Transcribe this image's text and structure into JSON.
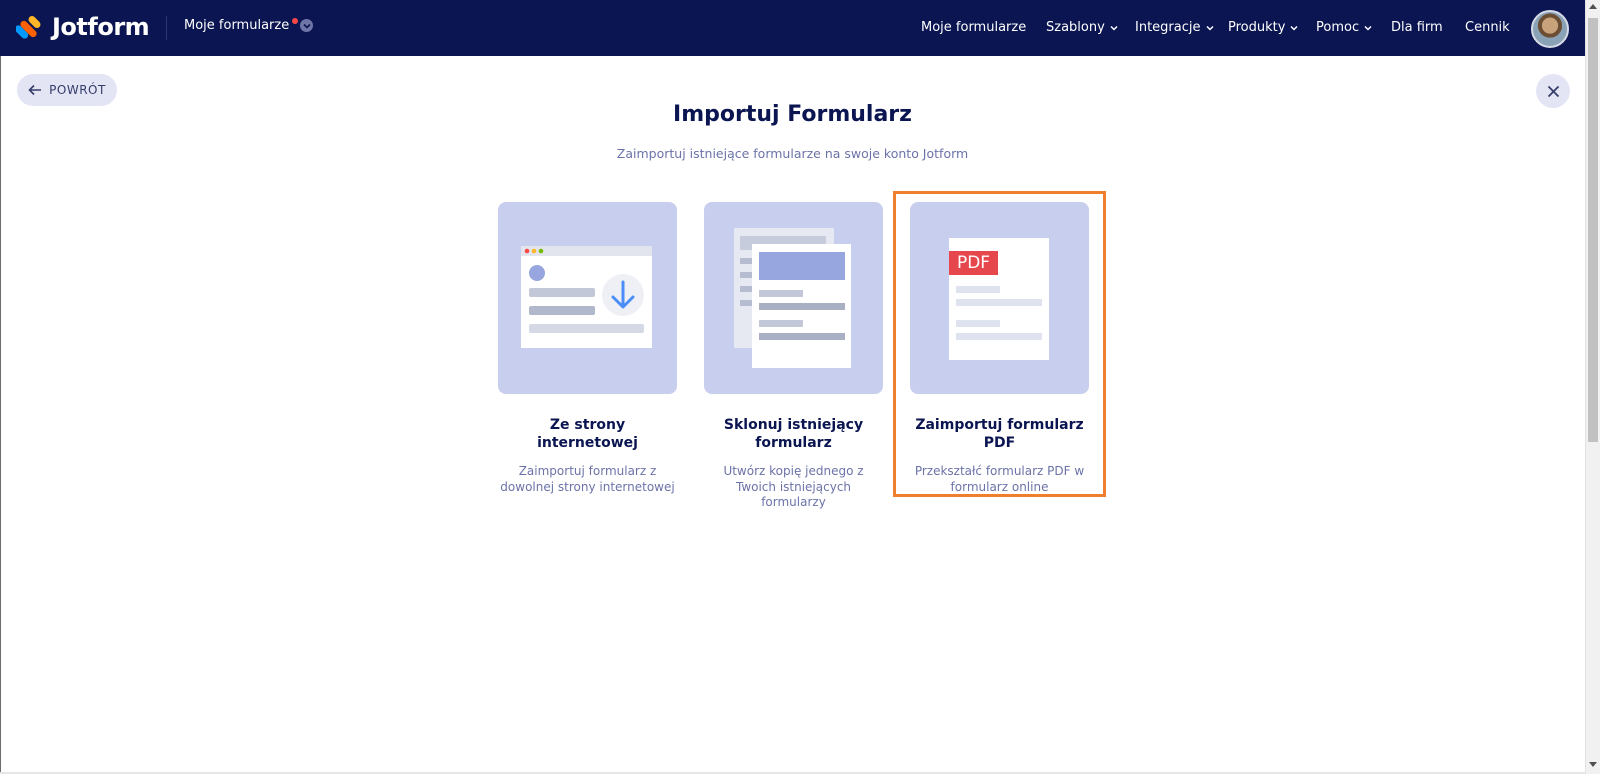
{
  "header": {
    "brand": "Jotform",
    "my_forms_label": "Moje formularze",
    "nav": [
      {
        "label": "Moje formularze",
        "has_dropdown": false
      },
      {
        "label": "Szablony",
        "has_dropdown": true
      },
      {
        "label": "Integracje",
        "has_dropdown": true
      },
      {
        "label": "Produkty",
        "has_dropdown": true
      },
      {
        "label": "Pomoc",
        "has_dropdown": true
      },
      {
        "label": "Dla firm",
        "has_dropdown": false
      },
      {
        "label": "Cennik",
        "has_dropdown": false
      }
    ]
  },
  "page": {
    "back_label": "POWRÓT",
    "title": "Importuj Formularz",
    "subtitle": "Zaimportuj istniejące formularze na swoje konto Jotform"
  },
  "cards": [
    {
      "title": "Ze strony internetowej",
      "desc": "Zaimportuj formularz z dowolnej strony internetowej"
    },
    {
      "title": "Sklonuj istniejący formularz",
      "desc": "Utwórz kopię jednego z Twoich istniejących formularzy"
    },
    {
      "title": "Zaimportuj formularz PDF",
      "desc": "Przekształć formularz PDF w formularz online",
      "pdf_badge": "PDF"
    }
  ],
  "colors": {
    "nav_bg": "#0a1551",
    "card_bg": "#c8ceed",
    "highlight": "#f07f2d",
    "accent_blue": "#4c8ef7",
    "pdf_red": "#e6474c"
  }
}
